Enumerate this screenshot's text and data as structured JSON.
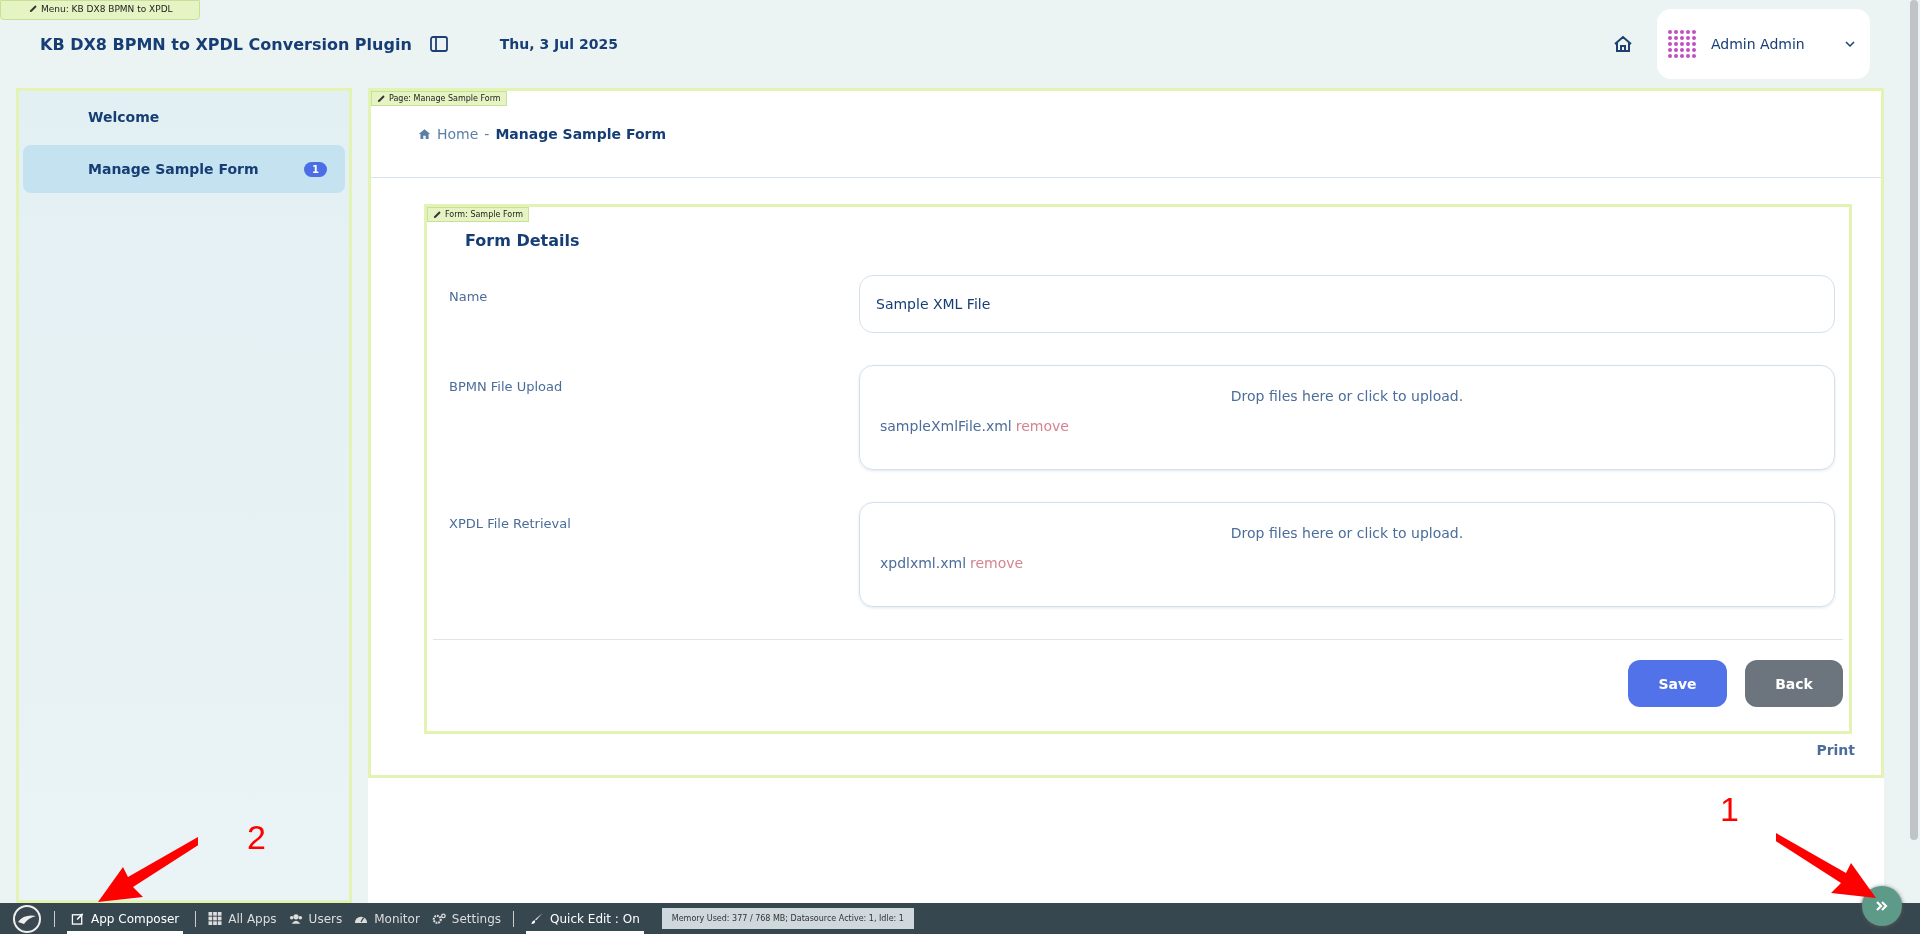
{
  "menu_tag": "Menu: KB DX8 BPMN to XPDL",
  "header": {
    "title": "KB DX8 BPMN to XPDL Conversion Plugin",
    "date": "Thu, 3 Jul 2025",
    "user": "Admin Admin"
  },
  "sidebar": {
    "items": [
      {
        "label": "Welcome",
        "selected": false
      },
      {
        "label": "Manage Sample Form",
        "selected": true,
        "badge": "1"
      }
    ]
  },
  "page": {
    "tag": "Page: Manage Sample Form",
    "breadcrumb": {
      "home": "Home",
      "separator": "-",
      "current": "Manage Sample Form"
    },
    "form": {
      "tag": "Form: Sample Form",
      "title": "Form Details",
      "fields": [
        {
          "kind": "text",
          "label": "Name",
          "value": "Sample XML File"
        },
        {
          "kind": "upload",
          "label": "BPMN File Upload",
          "hint": "Drop files here or click to upload.",
          "file": "sampleXmlFile.xml",
          "remove": "remove"
        },
        {
          "kind": "upload",
          "label": "XPDL File Retrieval",
          "hint": "Drop files here or click to upload.",
          "file": "xpdlxml.xml",
          "remove": "remove"
        }
      ],
      "buttons": [
        {
          "label": "Save",
          "kind": "primary"
        },
        {
          "label": "Back",
          "kind": "secondary"
        }
      ]
    },
    "print": "Print"
  },
  "bottom_bar": {
    "items": [
      {
        "label": "App Composer",
        "kind": "composer"
      },
      {
        "label": "All Apps",
        "kind": "apps"
      },
      {
        "label": "Users",
        "kind": "users"
      },
      {
        "label": "Monitor",
        "kind": "monitor"
      },
      {
        "label": "Settings",
        "kind": "settings"
      },
      {
        "label": "Quick Edit : On",
        "kind": "quickedit"
      }
    ],
    "memory": "Memory Used: 377 / 768 MB; Datasource Active: 1, Idle: 1"
  },
  "annotations": [
    {
      "label": "1",
      "kind": "right"
    },
    {
      "label": "2",
      "kind": "left"
    }
  ]
}
